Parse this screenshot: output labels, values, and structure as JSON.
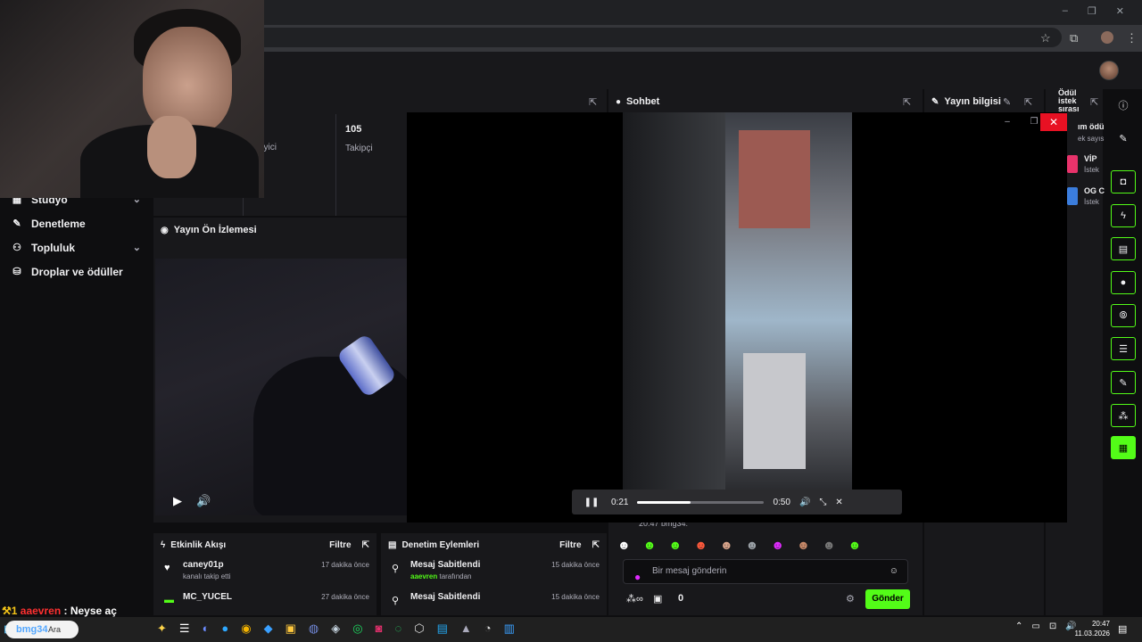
{
  "window": {
    "minimize": "–",
    "restore": "❐",
    "close": "✕"
  },
  "browser": {
    "star_icon": "☆",
    "ext_icon": "⧉",
    "menu_icon": "⋮"
  },
  "sidebar": {
    "items": [
      {
        "label": "Stüdyo",
        "icon": "layout-icon",
        "glyph": "▦",
        "chevron": "⌄"
      },
      {
        "label": "Denetleme",
        "icon": "wrench-icon",
        "glyph": "✎",
        "chevron": ""
      },
      {
        "label": "Topluluk",
        "icon": "users-icon",
        "glyph": "⚇",
        "chevron": "⌄"
      },
      {
        "label": "Droplar ve ödüller",
        "icon": "gift-icon",
        "glyph": "⛁",
        "chevron": ""
      }
    ]
  },
  "stats": {
    "followers_value": "105",
    "followers_label": "Takipçi",
    "viewer_fragment": "eyici"
  },
  "preview": {
    "title": "Yayın Ön İzlemesi",
    "play": "▶",
    "volume": "🔊"
  },
  "chat": {
    "title": "Sohbet",
    "partial_message": "20:47  bmg34:",
    "input_placeholder": "Bir mesaj gönderin",
    "points": "0",
    "send": "Gönder",
    "emotes": [
      "☻",
      "☻",
      "☻",
      "☻",
      "☻",
      "☻",
      "☻",
      "☻",
      "☻",
      "☻"
    ]
  },
  "info": {
    "title": "Yayın bilgisi",
    "edit_icon": "✎"
  },
  "queue": {
    "title": "Ödül istek sırası",
    "header_fragment": "ım ödül i",
    "sub_fragment": "ek sayısı -",
    "items": [
      {
        "name": "VİP",
        "sub": "İstek"
      },
      {
        "name": "OG C",
        "sub": "İstek"
      }
    ]
  },
  "player": {
    "current_time": "0:21",
    "duration": "0:50",
    "progress": 0.42,
    "pause": "❚❚",
    "volume": "🔊",
    "exit_fullscreen": "⤡",
    "close": "✕"
  },
  "activity": {
    "title": "Etkinlik Akışı",
    "filter": "Filtre",
    "events": [
      {
        "name": "caney01p",
        "detail": "kanalı takip etti",
        "time": "17 dakika önce",
        "glyph": "♥"
      },
      {
        "name": "MC_YUCEL",
        "detail": "",
        "time": "27 dakika önce",
        "glyph": "▬"
      }
    ]
  },
  "moderation": {
    "title": "Denetim Eylemleri",
    "filter": "Filtre",
    "events": [
      {
        "name": "Mesaj Sabitlendi",
        "actor": "aaevren",
        "suffix": " tarafından",
        "time": "15 dakika önce",
        "glyph": "⚲"
      },
      {
        "name": "Mesaj Sabitlendi",
        "actor": "",
        "suffix": "",
        "time": "15 dakika önce",
        "glyph": "⚲"
      }
    ]
  },
  "overlay_chat": {
    "badge": "⚒1",
    "user": "aaevren",
    "message": " : Neyse aç"
  },
  "taskbar": {
    "search": "Ara",
    "search_overlay": "bmg34",
    "icons": [
      "☰",
      "◐",
      "●",
      "◉",
      "◆",
      "▣",
      "◍",
      "◈",
      "◎",
      "◙",
      "◌",
      "⬡",
      "▤",
      "❮❯",
      "▲",
      "◔",
      "▥"
    ],
    "tray": [
      "⌃",
      "▭",
      "⊡",
      "🔊"
    ],
    "time": "20:47",
    "date": "11.03.2026",
    "notif": "▤"
  },
  "colors": {
    "accent": "#53fc18",
    "close_red": "#e81123",
    "panel": "#18181b",
    "background": "#0e0e10"
  }
}
